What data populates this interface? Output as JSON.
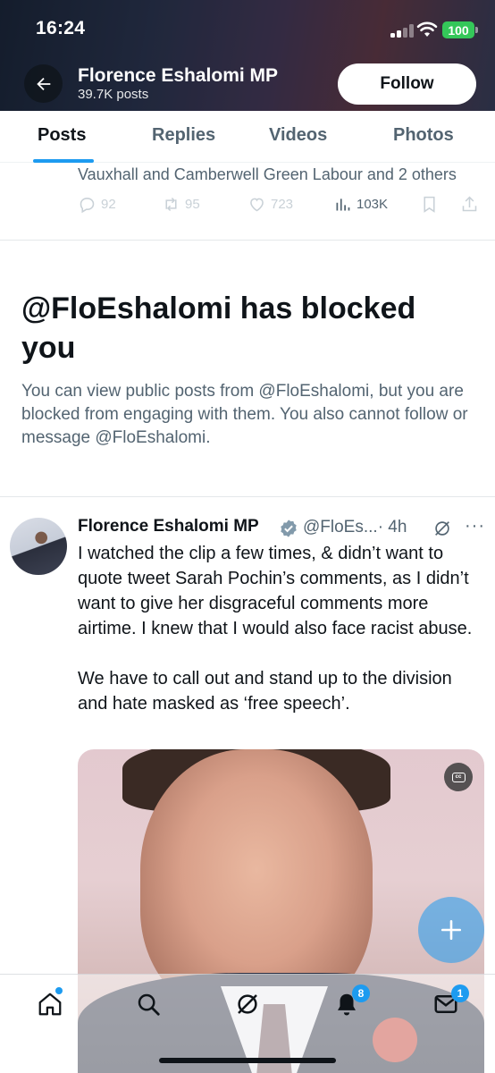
{
  "status_bar": {
    "time": "16:24",
    "battery": "100"
  },
  "profile": {
    "name": "Florence Eshalomi MP",
    "posts": "39.7K posts",
    "follow_label": "Follow"
  },
  "tabs": [
    {
      "label": "Posts",
      "active": true
    },
    {
      "label": "Replies",
      "active": false
    },
    {
      "label": "Videos",
      "active": false
    },
    {
      "label": "Photos",
      "active": false
    }
  ],
  "prev_tweet": {
    "social_context": "Vauxhall and Camberwell Green Labour and 2 others",
    "replies": "92",
    "reposts": "95",
    "likes": "723",
    "views": "103K"
  },
  "blocked": {
    "title": "@FloEshalomi has blocked you",
    "text": "You can view public posts from @FloEshalomi, but you are blocked from engaging with them. You also cannot follow or message @FloEshalomi."
  },
  "tweet": {
    "author": "Florence Eshalomi MP",
    "handle": "@FloEs...",
    "time": "· 4h",
    "body": "I watched the clip a few times, & didn’t want to quote tweet Sarah Pochin’s comments, as I didn’t want to give her disgraceful comments more airtime. I knew that I would also face racist abuse.\n\nWe have to call out and stand up to the division and hate masked as ‘free speech’.",
    "media_caption_icon": "cc"
  },
  "nav": {
    "notifications_badge": "8",
    "messages_badge": "1"
  },
  "colors": {
    "accent": "#1d9bf0",
    "text_primary": "#0f1419",
    "text_secondary": "#536471",
    "battery": "#34c759"
  },
  "icons": [
    "back-arrow-icon",
    "reply-icon",
    "repost-icon",
    "like-icon",
    "views-icon",
    "bookmark-icon",
    "share-icon",
    "verified-icon",
    "grok-icon",
    "more-icon",
    "closed-captions-icon",
    "compose-icon",
    "home-icon",
    "search-icon",
    "grok-nav-icon",
    "bell-icon",
    "mail-icon"
  ]
}
